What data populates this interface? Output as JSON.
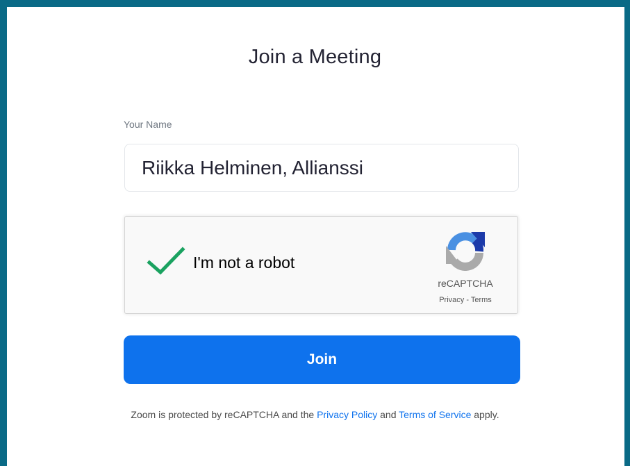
{
  "page": {
    "title": "Join a Meeting"
  },
  "form": {
    "name_label": "Your Name",
    "name_value": "Riikka Helminen, Allianssi"
  },
  "captcha": {
    "label": "I'm not a robot",
    "checked": true,
    "brand": "reCAPTCHA",
    "privacy_link": "Privacy",
    "separator": " - ",
    "terms_link": "Terms",
    "check_icon": "checkmark-icon",
    "logo_icon": "recaptcha-logo-icon"
  },
  "actions": {
    "join_label": "Join"
  },
  "footer": {
    "prefix": "Zoom is protected by reCAPTCHA and the ",
    "privacy_policy": "Privacy Policy",
    "and": " and ",
    "terms_of_service": "Terms of Service",
    "suffix": " apply."
  },
  "colors": {
    "frame_border": "#0a6a86",
    "primary_button": "#0e72ed",
    "link": "#0e72ed",
    "checkmark": "#1aa260"
  }
}
